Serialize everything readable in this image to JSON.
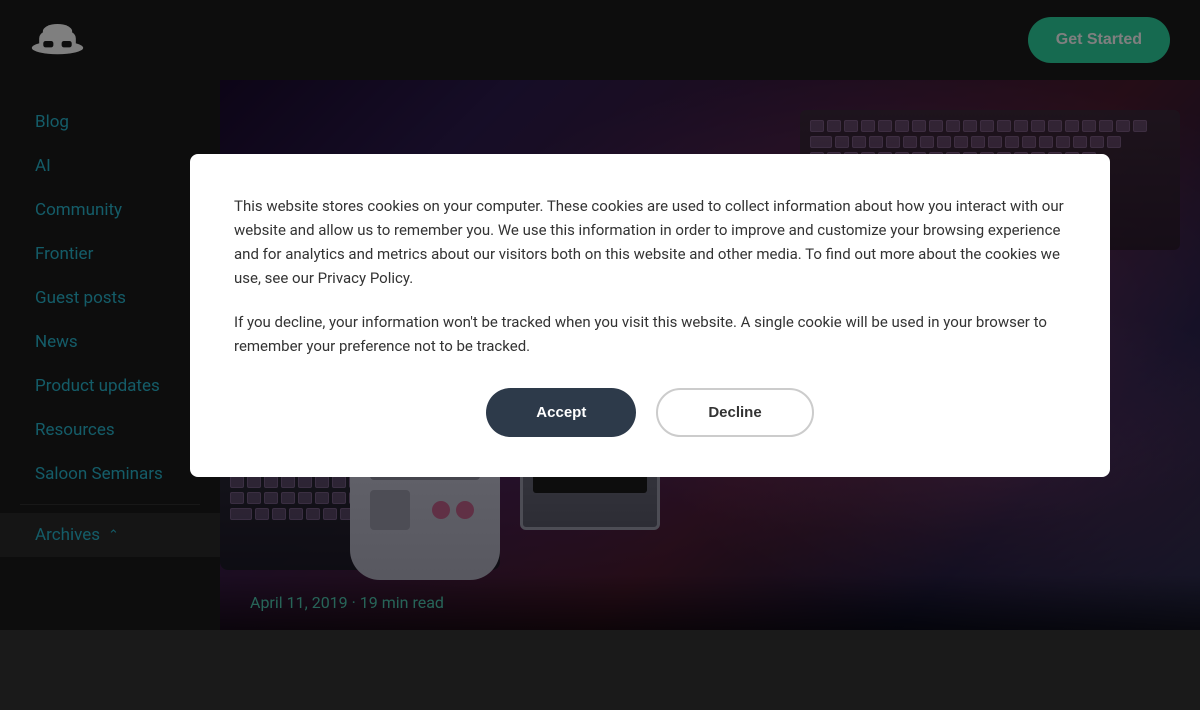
{
  "header": {
    "logo_alt": "Hat logo",
    "get_started_label": "Get Started"
  },
  "sidebar": {
    "items": [
      {
        "label": "Blog",
        "active": false
      },
      {
        "label": "AI",
        "active": false
      },
      {
        "label": "Community",
        "active": false
      },
      {
        "label": "Frontier",
        "active": false
      },
      {
        "label": "Guest posts",
        "active": false
      },
      {
        "label": "News",
        "active": false
      },
      {
        "label": "Product updates",
        "active": false
      },
      {
        "label": "Resources",
        "active": false
      },
      {
        "label": "Saloon Seminars",
        "active": false
      },
      {
        "label": "Archives",
        "active": true,
        "has_chevron": true
      }
    ]
  },
  "hero": {
    "date": "April 11, 2019 · 19 min read"
  },
  "cookie": {
    "text1": "This website stores cookies on your computer. These cookies are used to collect information about how you interact with our website and allow us to remember you. We use this information in order to improve and customize your browsing experience and for analytics and metrics about our visitors both on this website and other media. To find out more about the cookies we use, see our Privacy Policy.",
    "text2": "If you decline, your information won't be tracked when you visit this website. A single cookie will be used in your browser to remember your preference not to be tracked.",
    "accept_label": "Accept",
    "decline_label": "Decline"
  }
}
